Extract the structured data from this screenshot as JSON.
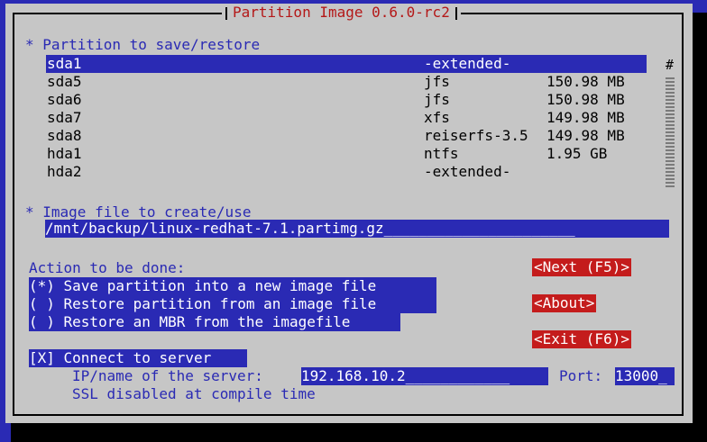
{
  "dialog": {
    "title": "Partition Image 0.6.0-rc2"
  },
  "partitions": {
    "label": "* Partition to save/restore",
    "scroll_marker": "#",
    "rows": [
      {
        "name": "sda1",
        "fs": "-extended-",
        "size": ""
      },
      {
        "name": "sda5",
        "fs": "jfs",
        "size": "150.98 MB"
      },
      {
        "name": "sda6",
        "fs": "jfs",
        "size": "150.98 MB"
      },
      {
        "name": "sda7",
        "fs": "xfs",
        "size": "149.98 MB"
      },
      {
        "name": "sda8",
        "fs": "reiserfs-3.5",
        "size": "149.98 MB"
      },
      {
        "name": "hda1",
        "fs": "ntfs",
        "size": "1.95 GB"
      },
      {
        "name": "hda2",
        "fs": "-extended-",
        "size": ""
      }
    ]
  },
  "image_file": {
    "label": "* Image file to create/use",
    "value": "/mnt/backup/linux-redhat-7.1.partimg.gz______________________"
  },
  "action": {
    "label": "Action to be done:",
    "options": [
      "(*) Save partition into a new image file",
      "( ) Restore partition from an image file",
      "( ) Restore an MBR from the imagefile"
    ]
  },
  "buttons": {
    "next": "<Next (F5)>",
    "about": "<About>",
    "exit": "<Exit (F6)>"
  },
  "server": {
    "connect": "[X] Connect to server",
    "ip_label": "IP/name of the server:",
    "ip_value": "192.168.10.2____________",
    "port_label": "Port:",
    "port_value": "13000_",
    "ssl_note": "SSL disabled at compile time"
  }
}
